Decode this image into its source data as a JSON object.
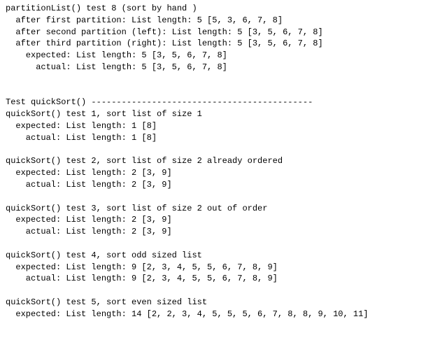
{
  "console": {
    "lines": [
      "partitionList() test 8 (sort by hand )",
      "  after first partition: List length: 5 [5, 3, 6, 7, 8]",
      "  after second partition (left): List length: 5 [3, 5, 6, 7, 8]",
      "  after third partition (right): List length: 5 [3, 5, 6, 7, 8]",
      "    expected: List length: 5 [3, 5, 6, 7, 8]",
      "      actual: List length: 5 [3, 5, 6, 7, 8]",
      "",
      "",
      "Test quickSort() --------------------------------------------",
      "quickSort() test 1, sort list of size 1",
      "  expected: List length: 1 [8]",
      "    actual: List length: 1 [8]",
      "",
      "quickSort() test 2, sort list of size 2 already ordered",
      "  expected: List length: 2 [3, 9]",
      "    actual: List length: 2 [3, 9]",
      "",
      "quickSort() test 3, sort list of size 2 out of order",
      "  expected: List length: 2 [3, 9]",
      "    actual: List length: 2 [3, 9]",
      "",
      "quickSort() test 4, sort odd sized list",
      "  expected: List length: 9 [2, 3, 4, 5, 5, 6, 7, 8, 9]",
      "    actual: List length: 9 [2, 3, 4, 5, 5, 6, 7, 8, 9]",
      "",
      "quickSort() test 5, sort even sized list",
      "  expected: List length: 14 [2, 2, 3, 4, 5, 5, 5, 6, 7, 8, 8, 9, 10, 11]"
    ]
  }
}
